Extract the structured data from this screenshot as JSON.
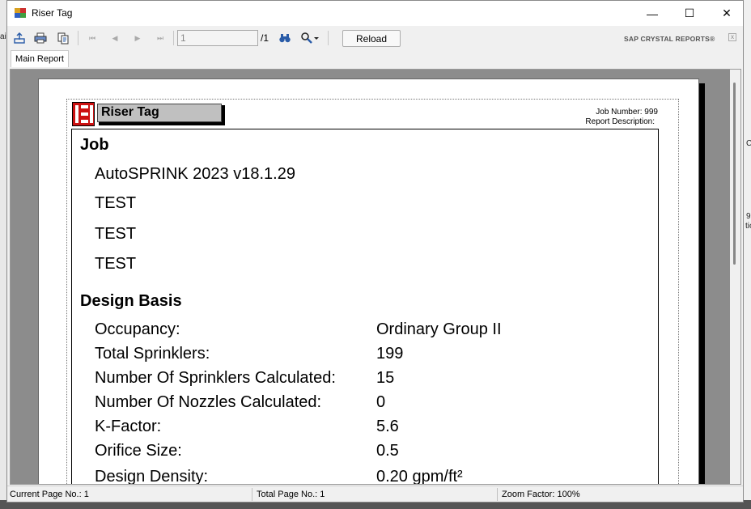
{
  "window": {
    "title": "Riser Tag",
    "minimize_glyph": "—",
    "maximize_glyph": "☐",
    "close_glyph": "✕"
  },
  "toolbar": {
    "export_icon": "export-icon",
    "print_icon": "print-icon",
    "copy_icon": "copy-icon",
    "first_glyph": "⏮",
    "prev_glyph": "◀",
    "next_glyph": "▶",
    "last_glyph": "⏭",
    "page_value": "1",
    "page_total": "/1",
    "find_glyph": "🔍",
    "zoom_glyph": "🔧",
    "reload_label": "Reload",
    "brand": "SAP CRYSTAL REPORTS®",
    "brand_close": "x"
  },
  "tabs": {
    "main": "Main Report"
  },
  "report": {
    "title": "Riser Tag",
    "job_number_line": "Job Number: 999",
    "report_description_line": "Report Description:",
    "job_heading": "Job",
    "job_lines": [
      "AutoSPRINK 2023 v18.1.29",
      "TEST",
      "TEST",
      "TEST"
    ],
    "design_heading": "Design Basis",
    "design_rows": [
      {
        "label": "Occupancy:",
        "value": "Ordinary Group II"
      },
      {
        "label": "Total Sprinklers:",
        "value": "199"
      },
      {
        "label": "Number Of Sprinklers Calculated:",
        "value": "15"
      },
      {
        "label": "Number Of Nozzles Calculated:",
        "value": "0"
      },
      {
        "label": "K-Factor:",
        "value": "5.6"
      },
      {
        "label": "Orifice Size:",
        "value": "0.5"
      },
      {
        "label": "Design Density:",
        "value": "0.20 gpm/ft²"
      }
    ]
  },
  "status": {
    "current_page": "Current Page No.: 1",
    "total_page": "Total Page No.: 1",
    "zoom": "Zoom Factor: 100%"
  },
  "background": {
    "left_fragment": "ai",
    "right_fragment_1": "9",
    "right_fragment_2": "tio",
    "right_fragment_3": "C"
  }
}
